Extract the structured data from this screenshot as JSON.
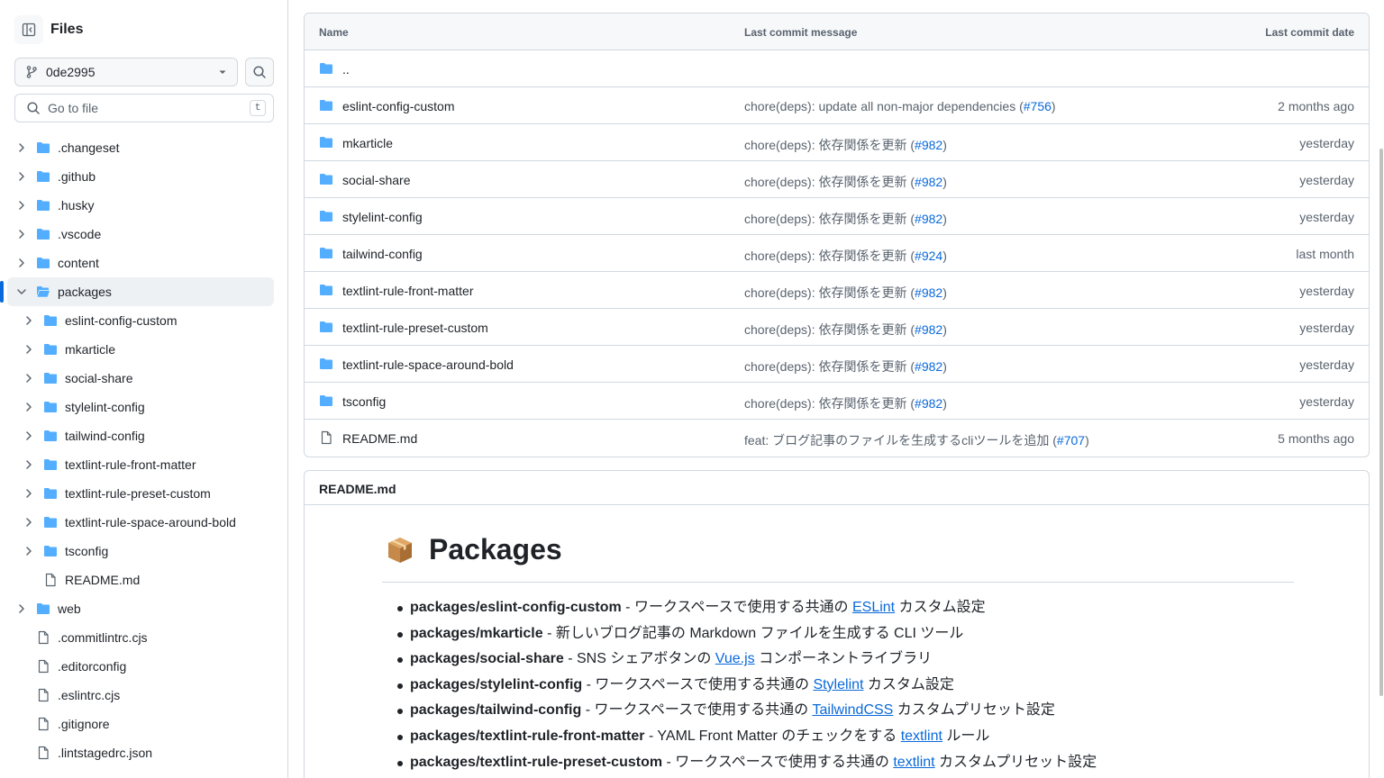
{
  "sidebar": {
    "title": "Files",
    "branch": "0de2995",
    "search_placeholder": "Go to file",
    "search_shortcut": "t",
    "tree": [
      {
        "label": ".changeset",
        "type": "folder",
        "depth": 0,
        "expanded": false
      },
      {
        "label": ".github",
        "type": "folder",
        "depth": 0,
        "expanded": false
      },
      {
        "label": ".husky",
        "type": "folder",
        "depth": 0,
        "expanded": false
      },
      {
        "label": ".vscode",
        "type": "folder",
        "depth": 0,
        "expanded": false
      },
      {
        "label": "content",
        "type": "folder",
        "depth": 0,
        "expanded": false
      },
      {
        "label": "packages",
        "type": "folder",
        "depth": 0,
        "expanded": true,
        "selected": true
      },
      {
        "label": "eslint-config-custom",
        "type": "folder",
        "depth": 1,
        "expanded": false
      },
      {
        "label": "mkarticle",
        "type": "folder",
        "depth": 1,
        "expanded": false
      },
      {
        "label": "social-share",
        "type": "folder",
        "depth": 1,
        "expanded": false
      },
      {
        "label": "stylelint-config",
        "type": "folder",
        "depth": 1,
        "expanded": false
      },
      {
        "label": "tailwind-config",
        "type": "folder",
        "depth": 1,
        "expanded": false
      },
      {
        "label": "textlint-rule-front-matter",
        "type": "folder",
        "depth": 1,
        "expanded": false
      },
      {
        "label": "textlint-rule-preset-custom",
        "type": "folder",
        "depth": 1,
        "expanded": false
      },
      {
        "label": "textlint-rule-space-around-bold",
        "type": "folder",
        "depth": 1,
        "expanded": false
      },
      {
        "label": "tsconfig",
        "type": "folder",
        "depth": 1,
        "expanded": false
      },
      {
        "label": "README.md",
        "type": "file",
        "depth": 1
      },
      {
        "label": "web",
        "type": "folder",
        "depth": 0,
        "expanded": false
      },
      {
        "label": ".commitlintrc.cjs",
        "type": "file",
        "depth": 0
      },
      {
        "label": ".editorconfig",
        "type": "file",
        "depth": 0
      },
      {
        "label": ".eslintrc.cjs",
        "type": "file",
        "depth": 0
      },
      {
        "label": ".gitignore",
        "type": "file",
        "depth": 0
      },
      {
        "label": ".lintstagedrc.json",
        "type": "file",
        "depth": 0
      }
    ]
  },
  "files_table": {
    "headers": {
      "name": "Name",
      "message": "Last commit message",
      "date": "Last commit date"
    },
    "rows": [
      {
        "name": "..",
        "type": "folder",
        "message": "",
        "pr": "",
        "suffix": "",
        "date": ""
      },
      {
        "name": "eslint-config-custom",
        "type": "folder",
        "message": "chore(deps): update all non-major dependencies (",
        "pr": "#756",
        "suffix": ")",
        "date": "2 months ago"
      },
      {
        "name": "mkarticle",
        "type": "folder",
        "message": "chore(deps): 依存関係を更新 (",
        "pr": "#982",
        "suffix": ")",
        "date": "yesterday"
      },
      {
        "name": "social-share",
        "type": "folder",
        "message": "chore(deps): 依存関係を更新 (",
        "pr": "#982",
        "suffix": ")",
        "date": "yesterday"
      },
      {
        "name": "stylelint-config",
        "type": "folder",
        "message": "chore(deps): 依存関係を更新 (",
        "pr": "#982",
        "suffix": ")",
        "date": "yesterday"
      },
      {
        "name": "tailwind-config",
        "type": "folder",
        "message": "chore(deps): 依存関係を更新 (",
        "pr": "#924",
        "suffix": ")",
        "date": "last month"
      },
      {
        "name": "textlint-rule-front-matter",
        "type": "folder",
        "message": "chore(deps): 依存関係を更新 (",
        "pr": "#982",
        "suffix": ")",
        "date": "yesterday"
      },
      {
        "name": "textlint-rule-preset-custom",
        "type": "folder",
        "message": "chore(deps): 依存関係を更新 (",
        "pr": "#982",
        "suffix": ")",
        "date": "yesterday"
      },
      {
        "name": "textlint-rule-space-around-bold",
        "type": "folder",
        "message": "chore(deps): 依存関係を更新 (",
        "pr": "#982",
        "suffix": ")",
        "date": "yesterday"
      },
      {
        "name": "tsconfig",
        "type": "folder",
        "message": "chore(deps): 依存関係を更新 (",
        "pr": "#982",
        "suffix": ")",
        "date": "yesterday"
      },
      {
        "name": "README.md",
        "type": "file",
        "message": "feat: ブログ記事のファイルを生成するcliツールを追加 (",
        "pr": "#707",
        "suffix": ")",
        "date": "5 months ago"
      }
    ]
  },
  "readme": {
    "filename": "README.md",
    "heading": "Packages",
    "heading_icon": "package-emoji",
    "items": [
      {
        "pkg": "packages/eslint-config-custom",
        "before": " - ワークスペースで使用する共通の ",
        "link": "ESLint",
        "after": " カスタム設定"
      },
      {
        "pkg": "packages/mkarticle",
        "before": " - 新しいブログ記事の Markdown ファイルを生成する CLI ツール",
        "link": "",
        "after": ""
      },
      {
        "pkg": "packages/social-share",
        "before": " - SNS シェアボタンの ",
        "link": "Vue.js",
        "after": " コンポーネントライブラリ"
      },
      {
        "pkg": "packages/stylelint-config",
        "before": " - ワークスペースで使用する共通の ",
        "link": "Stylelint",
        "after": " カスタム設定"
      },
      {
        "pkg": "packages/tailwind-config",
        "before": " - ワークスペースで使用する共通の ",
        "link": "TailwindCSS",
        "after": " カスタムプリセット設定"
      },
      {
        "pkg": "packages/textlint-rule-front-matter",
        "before": " - YAML Front Matter のチェックをする ",
        "link": "textlint",
        "after": " ルール"
      },
      {
        "pkg": "packages/textlint-rule-preset-custom",
        "before": " - ワークスペースで使用する共通の ",
        "link": "textlint",
        "after": " カスタムプリセット設定"
      }
    ]
  },
  "colors": {
    "accent": "#0969da",
    "folder": "#54aeff",
    "muted": "#59636e",
    "border": "#d1d9e0"
  }
}
